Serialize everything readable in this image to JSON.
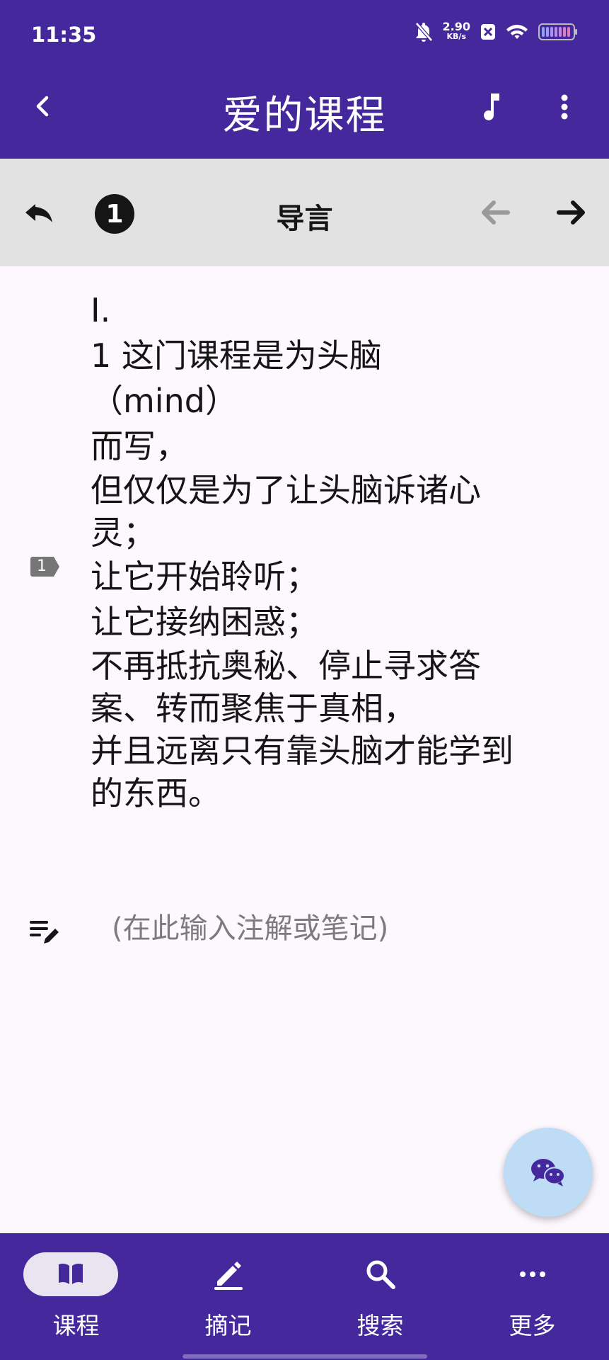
{
  "status_bar": {
    "time": "11:35",
    "net_speed_value": "2.90",
    "net_speed_unit": "KB/s",
    "icons": [
      "bell-off-icon",
      "close-box-icon",
      "wifi-icon",
      "battery-icon"
    ]
  },
  "app_bar": {
    "title": "爱的课程",
    "icons": [
      "back-chevron-icon",
      "music-note-icon",
      "more-vert-icon"
    ]
  },
  "toolbar": {
    "chapter_number": "1",
    "chapter_title": "导言",
    "icons": [
      "undo-arrow-icon",
      "arrow-left-icon",
      "arrow-right-icon"
    ],
    "prev_disabled": true
  },
  "content": {
    "paragraph_marker": "1",
    "lines": [
      "I.",
      "1 这门课程是为头脑",
      "（mind）",
      "而写，",
      "但仅仅是为了让头脑诉诸心灵；",
      "让它开始聆听；",
      "让它接纳困惑；",
      "不再抵抗奥秘、停止寻求答案、转而聚焦于真相，",
      "并且远离只有靠头脑才能学到的东西。"
    ],
    "note_placeholder": "(在此输入注解或笔记)"
  },
  "fab": {
    "icon": "wechat-icon"
  },
  "bottom_nav": {
    "items": [
      {
        "label": "课程",
        "icon": "book-icon",
        "active": true
      },
      {
        "label": "摘记",
        "icon": "pencil-icon",
        "active": false
      },
      {
        "label": "搜索",
        "icon": "search-icon",
        "active": false
      },
      {
        "label": "更多",
        "icon": "more-horiz-icon",
        "active": false
      }
    ]
  },
  "colors": {
    "primary": "#44289c",
    "toolbar_bg": "#e2e2e2",
    "background": "#fdf8fd",
    "fab_bg": "#bfdcf6",
    "text": "#151515"
  }
}
